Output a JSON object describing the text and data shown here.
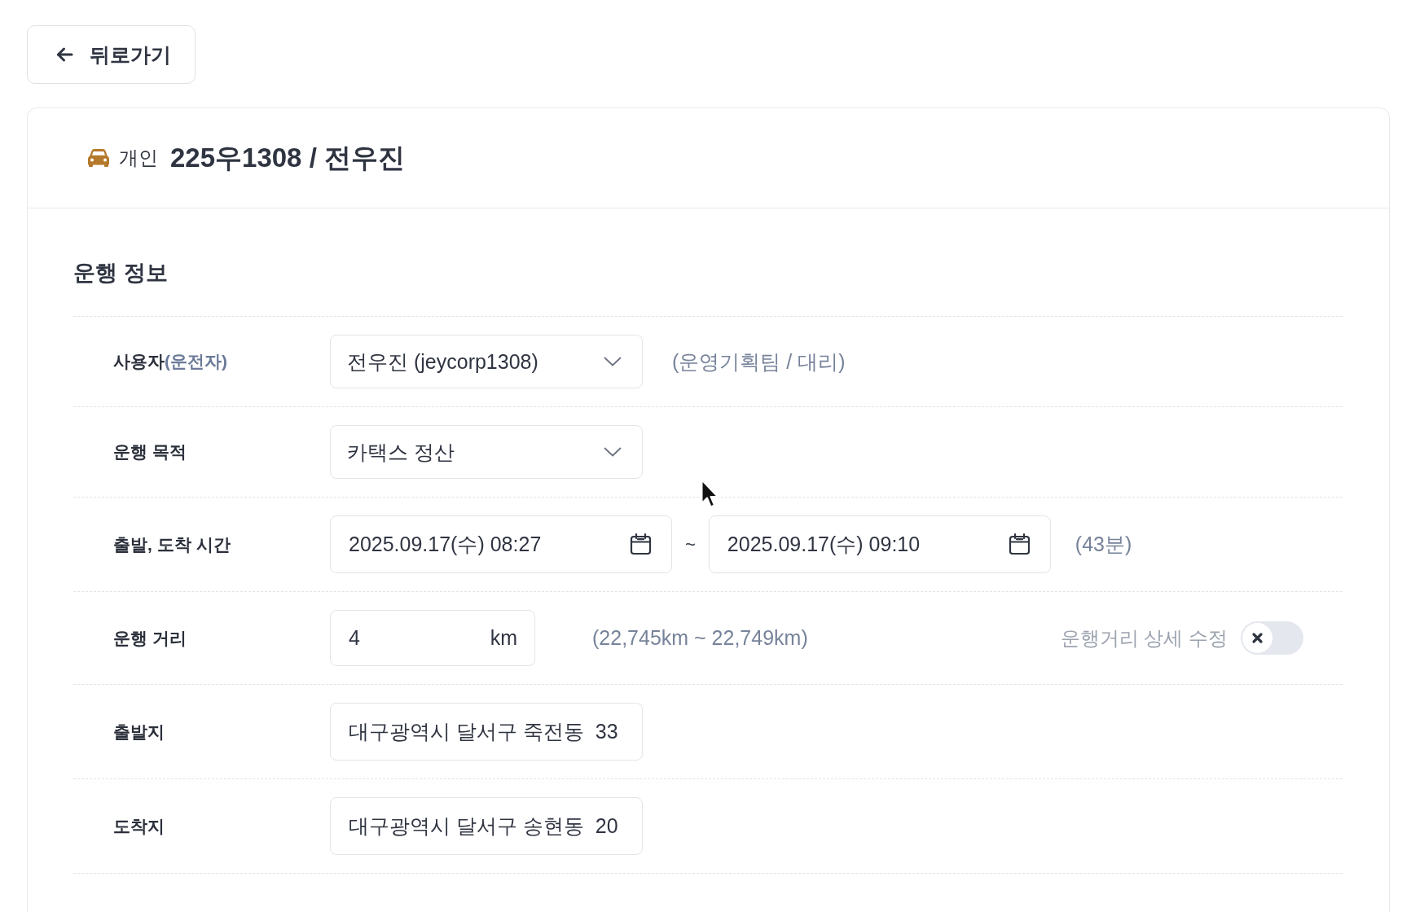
{
  "back_button": {
    "label": "뒤로가기"
  },
  "vehicle": {
    "type": "개인",
    "title": "225우1308 / 전우진"
  },
  "section": {
    "title": "운행 정보"
  },
  "rows": [
    {
      "kind": "select",
      "label": "사용자",
      "label_note": "(운전자)",
      "value": "전우진 (jeycorp1308)",
      "note": "(운영기획팀 / 대리)"
    },
    {
      "kind": "select",
      "label": "운행 목적",
      "value": "카택스 정산"
    },
    {
      "kind": "datetime_range",
      "label": "출발, 도착 시간",
      "start": "2025.09.17(수) 08:27",
      "separator": "~",
      "end": "2025.09.17(수) 09:10",
      "note": "(43분)"
    },
    {
      "kind": "distance",
      "label": "운행 거리",
      "value": "4",
      "unit": "km",
      "note": "(22,745km ~ 22,749km)",
      "toggle": {
        "label": "운행거리 상세 수정",
        "on": false
      }
    },
    {
      "kind": "text",
      "label": "출발지",
      "value": "대구광역시 달서구 죽전동  33"
    },
    {
      "kind": "text",
      "label": "도착지",
      "value": "대구광역시 달서구 송현동  20"
    }
  ]
}
